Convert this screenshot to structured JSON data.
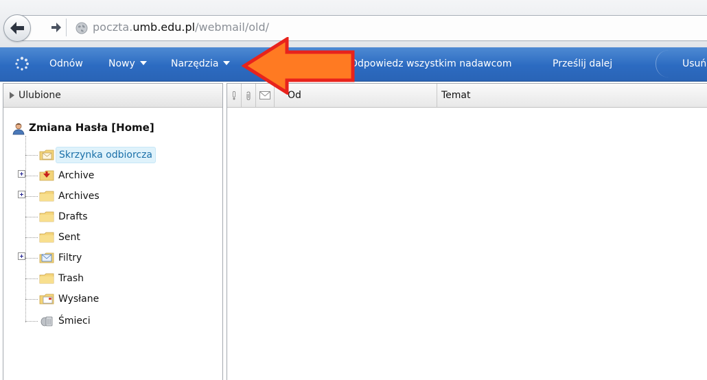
{
  "browser": {
    "url_prefix": "poczta.",
    "url_domain": "umb.edu.pl",
    "url_path": "/webmail/old/"
  },
  "toolbar": {
    "refresh_label": "Odnów",
    "new_label": "Nowy",
    "tools_label": "Narzędzia",
    "reply_all_label": "Odpowiedz wszystkim nadawcom",
    "forward_label": "Prześlij dalej",
    "delete_label": "Usuń"
  },
  "sidebar": {
    "favorites_label": "Ulubione",
    "account_name": "Zmiana Hasła [Home]",
    "folders": [
      {
        "label": "Skrzynka odbiorcza",
        "icon": "inbox-folder-icon",
        "selected": true,
        "expandable": false
      },
      {
        "label": "Archive",
        "icon": "archive-folder-icon",
        "selected": false,
        "expandable": true
      },
      {
        "label": "Archives",
        "icon": "folder-icon",
        "selected": false,
        "expandable": true
      },
      {
        "label": "Drafts",
        "icon": "folder-icon",
        "selected": false,
        "expandable": false
      },
      {
        "label": "Sent",
        "icon": "folder-icon",
        "selected": false,
        "expandable": false
      },
      {
        "label": "Filtry",
        "icon": "filter-folder-icon",
        "selected": false,
        "expandable": true
      },
      {
        "label": "Trash",
        "icon": "folder-icon",
        "selected": false,
        "expandable": false
      },
      {
        "label": "Wysłane",
        "icon": "sent-folder-icon",
        "selected": false,
        "expandable": false
      },
      {
        "label": "Śmieci",
        "icon": "junk-bin-icon",
        "selected": false,
        "expandable": false
      }
    ]
  },
  "message_list": {
    "columns": {
      "importance_icon": "importance-icon",
      "attachment_icon": "attachment-icon",
      "read_status_icon": "envelope-icon",
      "from_label": "Od",
      "subject_label": "Temat"
    }
  },
  "colors": {
    "toolbar_blue": "#2c6bc1",
    "annotation_arrow_fill": "#ff7a22",
    "annotation_arrow_border": "#e8231c",
    "selected_folder_bg": "#dff2fb"
  }
}
